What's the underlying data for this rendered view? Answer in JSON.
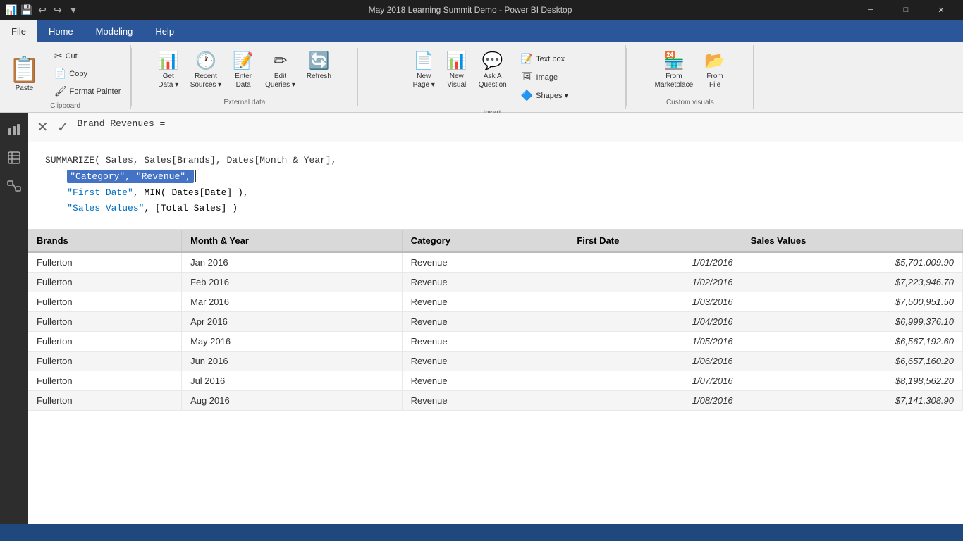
{
  "titleBar": {
    "title": "May 2018 Learning Summit Demo - Power BI Desktop",
    "icon": "📊"
  },
  "menuBar": {
    "items": [
      {
        "label": "File",
        "active": true
      },
      {
        "label": "Home",
        "active": false
      },
      {
        "label": "Modeling",
        "active": false
      },
      {
        "label": "Help",
        "active": false
      }
    ]
  },
  "ribbon": {
    "groups": [
      {
        "name": "clipboard",
        "label": "Clipboard",
        "buttons": [
          {
            "label": "Paste",
            "icon": "📋"
          },
          {
            "label": "Cut",
            "icon": "✂"
          },
          {
            "label": "Copy",
            "icon": "📄"
          },
          {
            "label": "Format Painter",
            "icon": "🖌"
          }
        ]
      },
      {
        "name": "external-data",
        "label": "External data",
        "buttons": [
          {
            "label": "Get Data",
            "icon": "📊",
            "hasDropdown": true
          },
          {
            "label": "Recent Sources",
            "icon": "🕐",
            "hasDropdown": true
          },
          {
            "label": "Enter Data",
            "icon": "📝"
          },
          {
            "label": "Edit Queries",
            "icon": "✏",
            "hasDropdown": true
          },
          {
            "label": "Refresh",
            "icon": "🔄"
          }
        ]
      },
      {
        "name": "insert",
        "label": "Insert",
        "buttons": [
          {
            "label": "New Page",
            "icon": "📄",
            "hasDropdown": true
          },
          {
            "label": "New Visual",
            "icon": "📊"
          },
          {
            "label": "Ask A Question",
            "icon": "💬"
          },
          {
            "label": "Text box",
            "icon": "📝"
          },
          {
            "label": "Image",
            "icon": "🖼"
          },
          {
            "label": "Shapes",
            "icon": "🔷",
            "hasDropdown": true
          }
        ]
      },
      {
        "name": "custom-visuals",
        "label": "Custom visuals",
        "buttons": [
          {
            "label": "From Marketplace",
            "icon": "🏪"
          },
          {
            "label": "From File",
            "icon": "📂"
          }
        ]
      }
    ]
  },
  "formula": {
    "content": "Brand Revenues =",
    "line1": "SUMMARIZE( Sales, Sales[Brands], Dates[Month & Year],",
    "line2_highlighted": "\"Category\", \"Revenue\",",
    "line3": "\"First Date\", MIN( Dates[Date] ),",
    "line4": "\"Sales Values\", [Total Sales] )"
  },
  "table": {
    "headers": [
      "Brands",
      "Month & Year",
      "Category",
      "First Date",
      "Sales Values"
    ],
    "rows": [
      [
        "Fullerton",
        "Jan 2016",
        "Revenue",
        "1/01/2016",
        "$5,701,009.90"
      ],
      [
        "Fullerton",
        "Feb 2016",
        "Revenue",
        "1/02/2016",
        "$7,223,946.70"
      ],
      [
        "Fullerton",
        "Mar 2016",
        "Revenue",
        "1/03/2016",
        "$7,500,951.50"
      ],
      [
        "Fullerton",
        "Apr 2016",
        "Revenue",
        "1/04/2016",
        "$6,999,376.10"
      ],
      [
        "Fullerton",
        "May 2016",
        "Revenue",
        "1/05/2016",
        "$6,567,192.60"
      ],
      [
        "Fullerton",
        "Jun 2016",
        "Revenue",
        "1/06/2016",
        "$6,657,160.20"
      ],
      [
        "Fullerton",
        "Jul 2016",
        "Revenue",
        "1/07/2016",
        "$8,198,562.20"
      ],
      [
        "Fullerton",
        "Aug 2016",
        "Revenue",
        "1/08/2016",
        "$7,141,308.90"
      ]
    ]
  },
  "sidebar": {
    "icons": [
      "📊",
      "⊞",
      "🔗"
    ]
  }
}
